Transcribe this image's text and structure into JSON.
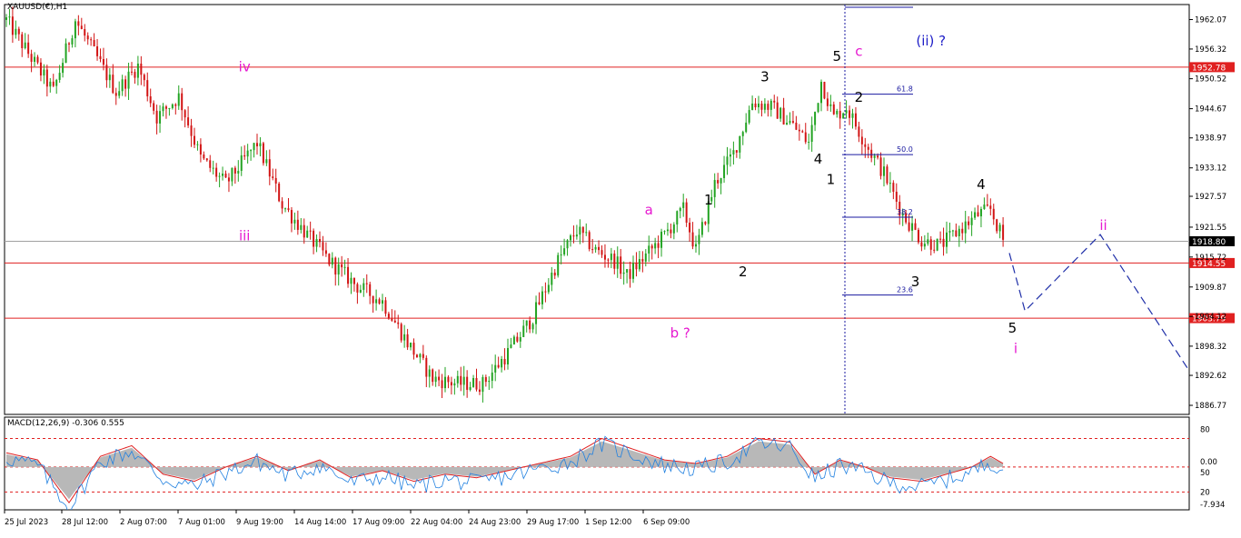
{
  "colors": {
    "bull": "#22a322",
    "bear": "#d21414",
    "hline": "#e02020",
    "price_line": "#a0a0a0",
    "fib": "#1a1aa0",
    "projection": "#1f2fa8",
    "pink": "#e619d0",
    "blue_label": "#2020c8",
    "macd_hist": "#b8b8b8",
    "macd_signal": "#e02020",
    "macd_line": "#2080e0"
  },
  "chart_data": [
    {
      "type": "candlestick",
      "title": "XAUUSD(€),H1",
      "ylim": [
        1885.0,
        1965.0
      ],
      "y_ticks": [
        "1962.07",
        "1956.32",
        "1950.52",
        "1944.67",
        "1938.97",
        "1933.12",
        "1927.57",
        "1921.55",
        "1915.72",
        "1909.87",
        "1904.12",
        "1898.32",
        "1892.62",
        "1886.77"
      ],
      "x_ticks": [
        "25 Jul 2023",
        "28 Jul 12:00",
        "2 Aug 07:00",
        "7 Aug 01:00",
        "9 Aug 19:00",
        "14 Aug 14:00",
        "17 Aug 09:00",
        "22 Aug 04:00",
        "24 Aug 23:00",
        "29 Aug 17:00",
        "1 Sep 12:00",
        "6 Sep 09:00"
      ],
      "anchors": [
        {
          "i": 0,
          "p": 1962
        },
        {
          "i": 15,
          "p": 1948
        },
        {
          "i": 22,
          "p": 1962
        },
        {
          "i": 35,
          "p": 1948
        },
        {
          "i": 42,
          "p": 1953
        },
        {
          "i": 48,
          "p": 1943
        },
        {
          "i": 55,
          "p": 1947
        },
        {
          "i": 62,
          "p": 1935
        },
        {
          "i": 70,
          "p": 1930
        },
        {
          "i": 80,
          "p": 1938
        },
        {
          "i": 88,
          "p": 1926
        },
        {
          "i": 96,
          "p": 1920
        },
        {
          "i": 103,
          "p": 1915
        },
        {
          "i": 112,
          "p": 1910
        },
        {
          "i": 120,
          "p": 1907
        },
        {
          "i": 128,
          "p": 1899
        },
        {
          "i": 136,
          "p": 1892
        },
        {
          "i": 144,
          "p": 1891
        },
        {
          "i": 152,
          "p": 1891
        },
        {
          "i": 160,
          "p": 1897
        },
        {
          "i": 168,
          "p": 1904
        },
        {
          "i": 176,
          "p": 1915
        },
        {
          "i": 182,
          "p": 1921
        },
        {
          "i": 188,
          "p": 1917
        },
        {
          "i": 194,
          "p": 1915
        },
        {
          "i": 198,
          "p": 1912
        },
        {
          "i": 204,
          "p": 1916
        },
        {
          "i": 210,
          "p": 1920
        },
        {
          "i": 216,
          "p": 1925
        },
        {
          "i": 220,
          "p": 1917
        },
        {
          "i": 226,
          "p": 1930
        },
        {
          "i": 232,
          "p": 1936
        },
        {
          "i": 238,
          "p": 1946
        },
        {
          "i": 244,
          "p": 1945
        },
        {
          "i": 250,
          "p": 1942
        },
        {
          "i": 256,
          "p": 1938
        },
        {
          "i": 260,
          "p": 1950
        },
        {
          "i": 264,
          "p": 1943
        },
        {
          "i": 268,
          "p": 1945
        },
        {
          "i": 274,
          "p": 1938
        },
        {
          "i": 280,
          "p": 1932
        },
        {
          "i": 286,
          "p": 1924
        },
        {
          "i": 292,
          "p": 1919
        },
        {
          "i": 298,
          "p": 1918
        },
        {
          "i": 304,
          "p": 1921
        },
        {
          "i": 310,
          "p": 1924
        },
        {
          "i": 314,
          "p": 1925
        },
        {
          "i": 318,
          "p": 1919
        }
      ],
      "candle_count": 319,
      "horizontal_levels": [
        {
          "price": 1952.78,
          "label": "1952.78",
          "color": "#e02020"
        },
        {
          "price": 1914.55,
          "label": "1914.55",
          "color": "#e02020"
        },
        {
          "price": 1903.79,
          "label": "1903.79",
          "color": "#e02020"
        },
        {
          "price": 1918.8,
          "label": "1918.80",
          "color": "#000000"
        }
      ],
      "fib_levels": [
        {
          "label": "61.8",
          "price": 1947.5
        },
        {
          "label": "50.0",
          "price": 1935.7
        },
        {
          "label": "38.2",
          "price": 1923.5
        },
        {
          "label": "23.6",
          "price": 1908.3
        }
      ],
      "projection_path": [
        {
          "i": 320,
          "p": 1916.5
        },
        {
          "i": 325,
          "p": 1905.2
        },
        {
          "i": 349,
          "p": 1920.1
        },
        {
          "i": 387,
          "p": 1884.5
        }
      ],
      "wave_labels": [
        {
          "text": "iv",
          "i": 76,
          "p": 1952,
          "color": "pink",
          "size": 15
        },
        {
          "text": "iii",
          "i": 76,
          "p": 1919,
          "color": "pink",
          "size": 15
        },
        {
          "text": "a",
          "i": 205,
          "p": 1924,
          "color": "pink",
          "size": 15
        },
        {
          "text": "b ?",
          "i": 215,
          "p": 1900,
          "color": "pink",
          "size": 15
        },
        {
          "text": "1",
          "i": 224,
          "p": 1926,
          "color": "black",
          "size": 15
        },
        {
          "text": "2",
          "i": 235,
          "p": 1912,
          "color": "black",
          "size": 15
        },
        {
          "text": "3",
          "i": 242,
          "p": 1950,
          "color": "black",
          "size": 15
        },
        {
          "text": "4",
          "i": 259,
          "p": 1934,
          "color": "black",
          "size": 15
        },
        {
          "text": "1",
          "i": 263,
          "p": 1930,
          "color": "black",
          "size": 15
        },
        {
          "text": "5",
          "i": 265,
          "p": 1954,
          "color": "black",
          "size": 15
        },
        {
          "text": "c",
          "i": 272,
          "p": 1955,
          "color": "pink",
          "size": 15
        },
        {
          "text": "(ii) ?",
          "i": 295,
          "p": 1957,
          "color": "blue_label",
          "size": 15
        },
        {
          "text": "2",
          "i": 272,
          "p": 1946,
          "color": "black",
          "size": 15
        },
        {
          "text": "3",
          "i": 290,
          "p": 1910,
          "color": "black",
          "size": 15
        },
        {
          "text": "4",
          "i": 311,
          "p": 1929,
          "color": "black",
          "size": 15
        },
        {
          "text": "5",
          "i": 321,
          "p": 1901,
          "color": "black",
          "size": 15
        },
        {
          "text": "i",
          "i": 322,
          "p": 1897,
          "color": "pink",
          "size": 15
        },
        {
          "text": "ii",
          "i": 350,
          "p": 1921,
          "color": "pink",
          "size": 15
        }
      ]
    },
    {
      "type": "line",
      "title": "MACD(12,26,9) -0.306 0.555",
      "ylim": [
        -12.0,
        14.0
      ],
      "y_ticks": [
        "80",
        "0.00",
        "50",
        "20",
        "-7.934"
      ],
      "levels": [
        8.0,
        0.0,
        -7.0
      ],
      "anchors": [
        {
          "i": 0,
          "v": 4
        },
        {
          "i": 10,
          "v": 2
        },
        {
          "i": 20,
          "v": -10
        },
        {
          "i": 30,
          "v": 3
        },
        {
          "i": 40,
          "v": 6
        },
        {
          "i": 50,
          "v": -2
        },
        {
          "i": 60,
          "v": -4
        },
        {
          "i": 70,
          "v": 0
        },
        {
          "i": 80,
          "v": 3
        },
        {
          "i": 90,
          "v": -1
        },
        {
          "i": 100,
          "v": 2
        },
        {
          "i": 110,
          "v": -3
        },
        {
          "i": 120,
          "v": -1
        },
        {
          "i": 130,
          "v": -4
        },
        {
          "i": 140,
          "v": -2
        },
        {
          "i": 150,
          "v": -3
        },
        {
          "i": 160,
          "v": -1
        },
        {
          "i": 170,
          "v": 1
        },
        {
          "i": 180,
          "v": 3
        },
        {
          "i": 190,
          "v": 8
        },
        {
          "i": 200,
          "v": 5
        },
        {
          "i": 210,
          "v": 2
        },
        {
          "i": 220,
          "v": 1
        },
        {
          "i": 230,
          "v": 3
        },
        {
          "i": 240,
          "v": 8
        },
        {
          "i": 250,
          "v": 7
        },
        {
          "i": 258,
          "v": -2
        },
        {
          "i": 266,
          "v": 2
        },
        {
          "i": 274,
          "v": 0
        },
        {
          "i": 282,
          "v": -3
        },
        {
          "i": 292,
          "v": -4
        },
        {
          "i": 300,
          "v": -2
        },
        {
          "i": 308,
          "v": 0
        },
        {
          "i": 314,
          "v": 3
        },
        {
          "i": 318,
          "v": 1
        }
      ]
    }
  ]
}
